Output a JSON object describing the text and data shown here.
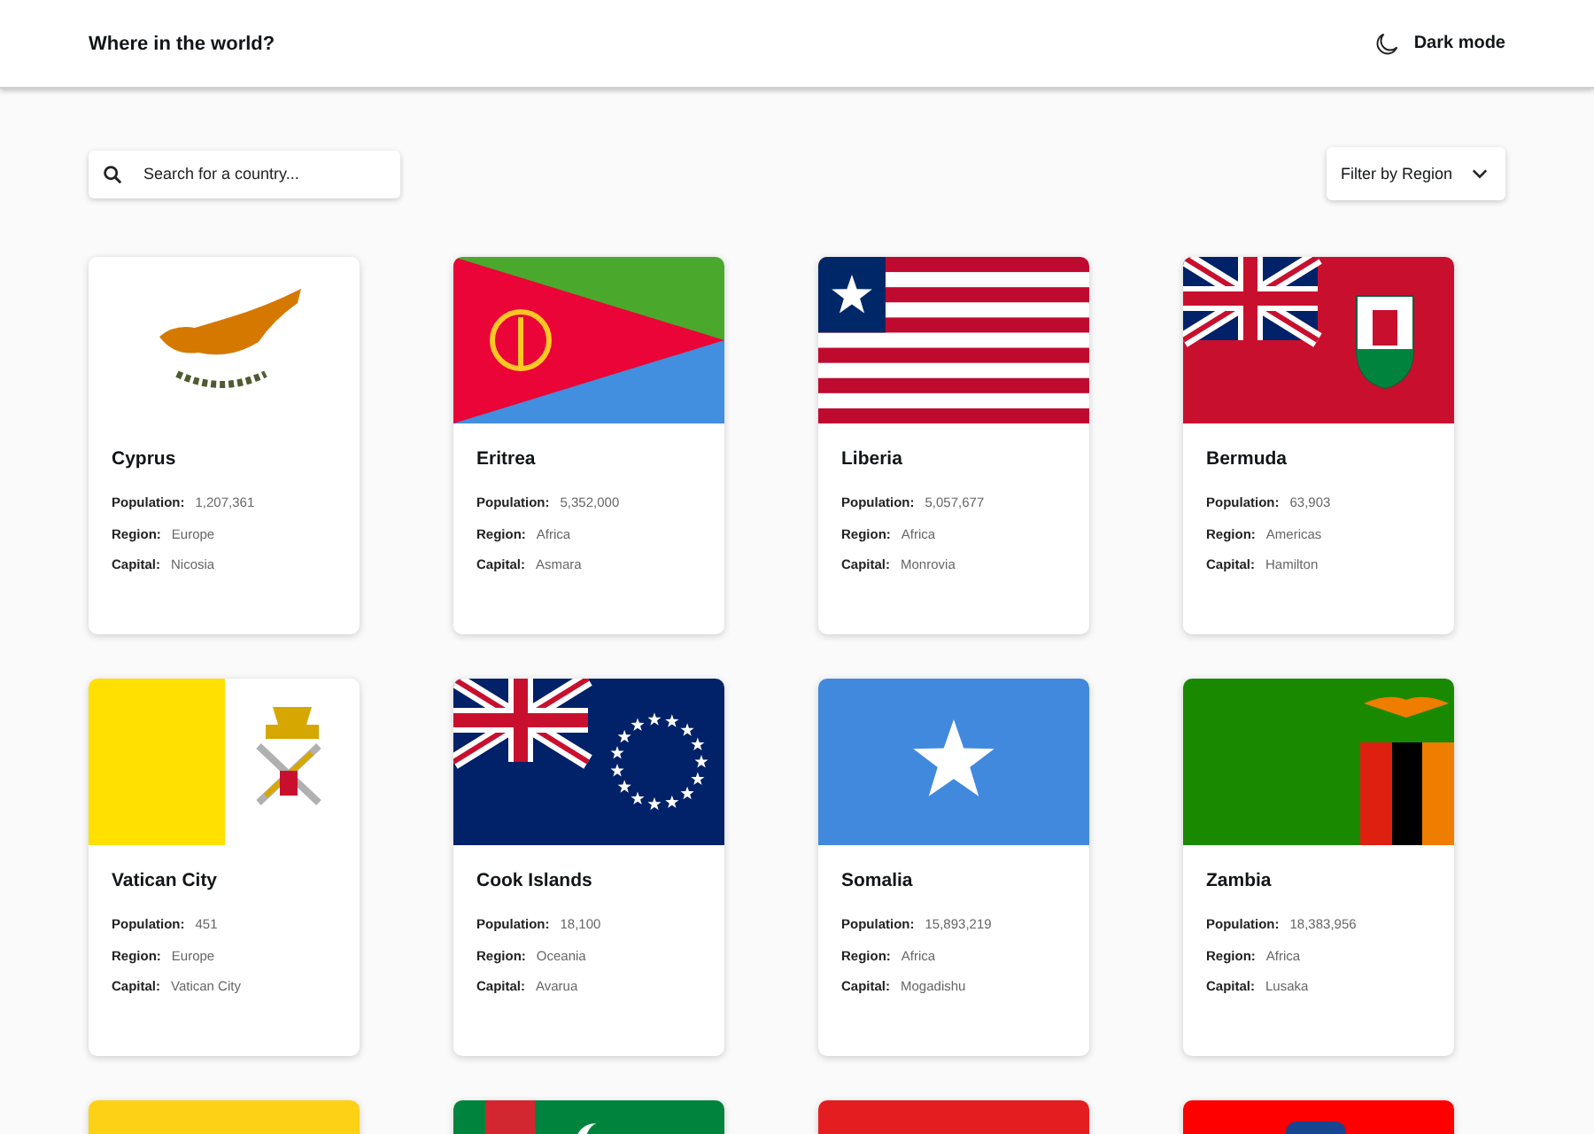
{
  "header": {
    "title": "Where in the world?",
    "theme_toggle": "Dark mode"
  },
  "search": {
    "placeholder": "Search for a country..."
  },
  "filter": {
    "label": "Filter by Region"
  },
  "countries": [
    {
      "kind": "cyprus",
      "name": "Cyprus",
      "stats": [
        {
          "label": "Population:",
          "value": "1,207,361"
        },
        {
          "label": "Region:",
          "value": "Europe"
        },
        {
          "label": "Capital:",
          "value": "Nicosia"
        }
      ]
    },
    {
      "kind": "eritrea",
      "name": "Eritrea",
      "stats": [
        {
          "label": "Population:",
          "value": "5,352,000"
        },
        {
          "label": "Region:",
          "value": "Africa"
        },
        {
          "label": "Capital:",
          "value": "Asmara"
        }
      ]
    },
    {
      "kind": "liberia",
      "name": "Liberia",
      "stats": [
        {
          "label": "Population:",
          "value": "5,057,677"
        },
        {
          "label": "Region:",
          "value": "Africa"
        },
        {
          "label": "Capital:",
          "value": "Monrovia"
        }
      ]
    },
    {
      "kind": "bermuda",
      "name": "Bermuda",
      "stats": [
        {
          "label": "Population:",
          "value": "63,903"
        },
        {
          "label": "Region:",
          "value": "Americas"
        },
        {
          "label": "Capital:",
          "value": "Hamilton"
        }
      ]
    },
    {
      "kind": "vatican",
      "name": "Vatican City",
      "stats": [
        {
          "label": "Population:",
          "value": "451"
        },
        {
          "label": "Region:",
          "value": "Europe"
        },
        {
          "label": "Capital:",
          "value": "Vatican City"
        }
      ]
    },
    {
      "kind": "cook-islands",
      "name": "Cook Islands",
      "stats": [
        {
          "label": "Population:",
          "value": "18,100"
        },
        {
          "label": "Region:",
          "value": "Oceania"
        },
        {
          "label": "Capital:",
          "value": "Avarua"
        }
      ]
    },
    {
      "kind": "somalia",
      "name": "Somalia",
      "stats": [
        {
          "label": "Population:",
          "value": "15,893,219"
        },
        {
          "label": "Region:",
          "value": "Africa"
        },
        {
          "label": "Capital:",
          "value": "Mogadishu"
        }
      ]
    },
    {
      "kind": "zambia",
      "name": "Zambia",
      "stats": [
        {
          "label": "Population:",
          "value": "18,383,956"
        },
        {
          "label": "Region:",
          "value": "Africa"
        },
        {
          "label": "Capital:",
          "value": "Lusaka"
        }
      ]
    },
    {
      "kind": "yellow"
    },
    {
      "kind": "turkmenistan"
    },
    {
      "kind": "albania"
    },
    {
      "kind": "red-emblem"
    }
  ]
}
